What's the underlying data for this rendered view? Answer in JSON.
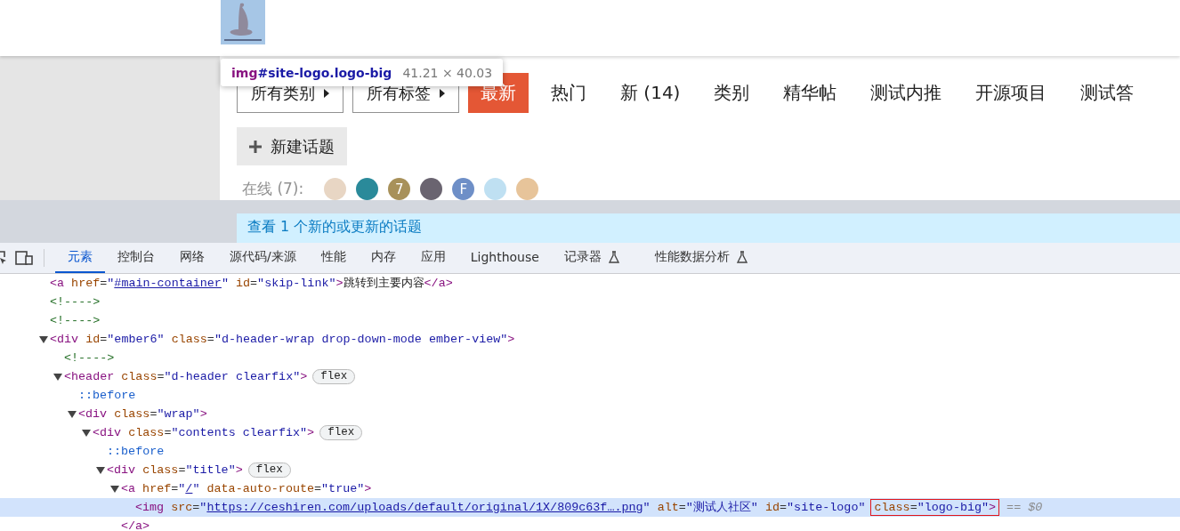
{
  "site": {
    "logo": {
      "kind": "hat"
    },
    "inspect_tooltip": {
      "tag": "img",
      "selector": "#site-logo.logo-big",
      "size": "41.21 × 40.03"
    },
    "filters": [
      {
        "label": "所有类别"
      },
      {
        "label": "所有标签"
      }
    ],
    "nav_tabs": [
      {
        "label": "最新",
        "selected": true
      },
      {
        "label": "热门",
        "selected": false
      },
      {
        "label": "新 (14)",
        "selected": false
      },
      {
        "label": "类别",
        "selected": false
      },
      {
        "label": "精华帖",
        "selected": false
      },
      {
        "label": "测试内推",
        "selected": false
      },
      {
        "label": "开源项目",
        "selected": false
      },
      {
        "label": "测试答",
        "selected": false
      }
    ],
    "new_topic_button": "新建话题",
    "online_label": "在线 (7):",
    "online_users": [
      {
        "kind": "photo",
        "color": "#e8d6c4"
      },
      {
        "kind": "photo",
        "color": "#2a8a9a"
      },
      {
        "kind": "letter",
        "letter": "7",
        "color": "#a8915a"
      },
      {
        "kind": "photo",
        "color": "#6a6470"
      },
      {
        "kind": "letter",
        "letter": "F",
        "color": "#6e8fc7"
      },
      {
        "kind": "photo",
        "color": "#bfe0f2"
      },
      {
        "kind": "photo",
        "color": "#e7c49a"
      }
    ],
    "banner": "查看 1 个新的或更新的话题"
  },
  "devtools": {
    "tabs": [
      {
        "label": "元素",
        "selected": true,
        "experimental": false
      },
      {
        "label": "控制台",
        "selected": false,
        "experimental": false
      },
      {
        "label": "网络",
        "selected": false,
        "experimental": false
      },
      {
        "label": "源代码/来源",
        "selected": false,
        "experimental": false
      },
      {
        "label": "性能",
        "selected": false,
        "experimental": false
      },
      {
        "label": "内存",
        "selected": false,
        "experimental": false
      },
      {
        "label": "应用",
        "selected": false,
        "experimental": false
      },
      {
        "label": "Lighthouse",
        "selected": false,
        "experimental": false
      },
      {
        "label": "记录器",
        "selected": false,
        "experimental": true
      },
      {
        "label": "性能数据分析",
        "selected": false,
        "experimental": true
      }
    ],
    "dom_tree": [
      {
        "parts": [
          {
            "kind": "tag",
            "text": "<a "
          },
          {
            "kind": "attr",
            "text": "href"
          },
          {
            "kind": "punct",
            "text": "="
          },
          {
            "kind": "value",
            "text": "\""
          },
          {
            "kind": "link",
            "text": "#main-container"
          },
          {
            "kind": "value",
            "text": "\""
          },
          {
            "kind": "attr",
            "text": " id"
          },
          {
            "kind": "punct",
            "text": "="
          },
          {
            "kind": "value",
            "text": "\"skip-link\""
          },
          {
            "kind": "tag",
            "text": ">"
          },
          {
            "kind": "text",
            "text": "跳转到主要内容"
          },
          {
            "kind": "tag",
            "text": "</a>"
          }
        ]
      },
      {
        "parts": [
          {
            "kind": "comment",
            "text": "<!---->"
          }
        ]
      },
      {
        "parts": [
          {
            "kind": "comment",
            "text": "<!---->"
          }
        ]
      },
      {
        "expanded": true,
        "parts": [
          {
            "kind": "tag",
            "text": "<div "
          },
          {
            "kind": "attr",
            "text": "id"
          },
          {
            "kind": "punct",
            "text": "="
          },
          {
            "kind": "value",
            "text": "\"ember6\""
          },
          {
            "kind": "attr",
            "text": " class"
          },
          {
            "kind": "punct",
            "text": "="
          },
          {
            "kind": "value",
            "text": "\"d-header-wrap drop-down-mode ember-view\""
          },
          {
            "kind": "tag",
            "text": ">"
          }
        ],
        "children": [
          {
            "parts": [
              {
                "kind": "comment",
                "text": "<!---->"
              }
            ]
          },
          {
            "expanded": true,
            "badge": "flex",
            "parts": [
              {
                "kind": "tag",
                "text": "<header "
              },
              {
                "kind": "attr",
                "text": "class"
              },
              {
                "kind": "punct",
                "text": "="
              },
              {
                "kind": "value",
                "text": "\"d-header clearfix\""
              },
              {
                "kind": "tag",
                "text": ">"
              }
            ],
            "children": [
              {
                "parts": [
                  {
                    "kind": "pseudo",
                    "text": "::before"
                  }
                ]
              },
              {
                "expanded": true,
                "parts": [
                  {
                    "kind": "tag",
                    "text": "<div "
                  },
                  {
                    "kind": "attr",
                    "text": "class"
                  },
                  {
                    "kind": "punct",
                    "text": "="
                  },
                  {
                    "kind": "value",
                    "text": "\"wrap\""
                  },
                  {
                    "kind": "tag",
                    "text": ">"
                  }
                ],
                "children": [
                  {
                    "expanded": true,
                    "badge": "flex",
                    "parts": [
                      {
                        "kind": "tag",
                        "text": "<div "
                      },
                      {
                        "kind": "attr",
                        "text": "class"
                      },
                      {
                        "kind": "punct",
                        "text": "="
                      },
                      {
                        "kind": "value",
                        "text": "\"contents clearfix\""
                      },
                      {
                        "kind": "tag",
                        "text": ">"
                      }
                    ],
                    "children": [
                      {
                        "parts": [
                          {
                            "kind": "pseudo",
                            "text": "::before"
                          }
                        ]
                      },
                      {
                        "expanded": true,
                        "badge": "flex",
                        "parts": [
                          {
                            "kind": "tag",
                            "text": "<div "
                          },
                          {
                            "kind": "attr",
                            "text": "class"
                          },
                          {
                            "kind": "punct",
                            "text": "="
                          },
                          {
                            "kind": "value",
                            "text": "\"title\""
                          },
                          {
                            "kind": "tag",
                            "text": ">"
                          }
                        ],
                        "children": [
                          {
                            "expanded": true,
                            "parts": [
                              {
                                "kind": "tag",
                                "text": "<a "
                              },
                              {
                                "kind": "attr",
                                "text": "href"
                              },
                              {
                                "kind": "punct",
                                "text": "="
                              },
                              {
                                "kind": "value",
                                "text": "\""
                              },
                              {
                                "kind": "link",
                                "text": "/"
                              },
                              {
                                "kind": "value",
                                "text": "\""
                              },
                              {
                                "kind": "attr",
                                "text": " data-auto-route"
                              },
                              {
                                "kind": "punct",
                                "text": "="
                              },
                              {
                                "kind": "value",
                                "text": "\"true\""
                              },
                              {
                                "kind": "tag",
                                "text": ">"
                              }
                            ],
                            "closing": "</a>",
                            "children": [
                              {
                                "selected": true,
                                "parts": [
                                  {
                                    "kind": "tag",
                                    "text": "<img "
                                  },
                                  {
                                    "kind": "attr",
                                    "text": "src"
                                  },
                                  {
                                    "kind": "punct",
                                    "text": "="
                                  },
                                  {
                                    "kind": "value",
                                    "text": "\""
                                  },
                                  {
                                    "kind": "link",
                                    "text": "https://ceshiren.com/uploads/default/original/1X/809c63f….png"
                                  },
                                  {
                                    "kind": "value",
                                    "text": "\""
                                  },
                                  {
                                    "kind": "attr",
                                    "text": " alt"
                                  },
                                  {
                                    "kind": "punct",
                                    "text": "="
                                  },
                                  {
                                    "kind": "value",
                                    "text": "\"测试人社区\""
                                  },
                                  {
                                    "kind": "attr",
                                    "text": " id"
                                  },
                                  {
                                    "kind": "punct",
                                    "text": "="
                                  },
                                  {
                                    "kind": "value",
                                    "text": "\"site-logo\""
                                  }
                                ],
                                "annotated_parts": [
                                  {
                                    "kind": "attr",
                                    "text": "class"
                                  },
                                  {
                                    "kind": "punct",
                                    "text": "="
                                  },
                                  {
                                    "kind": "value",
                                    "text": "\"logo-big\""
                                  },
                                  {
                                    "kind": "tag",
                                    "text": ">"
                                  }
                                ],
                                "console_ref": "== $0"
                              }
                            ]
                          }
                        ]
                      }
                    ]
                  }
                ]
              }
            ]
          }
        ]
      }
    ]
  }
}
